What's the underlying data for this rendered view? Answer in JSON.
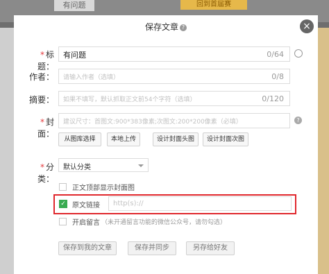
{
  "background": {
    "tab_label": "有问题",
    "banner_label": "回到首届赛"
  },
  "dialog": {
    "title": "保存文章",
    "close_label": "×"
  },
  "fields": {
    "title": {
      "label": "标题：",
      "value": "有问题",
      "count": "0/64"
    },
    "author": {
      "label": "作者：",
      "placeholder": "请输入作者（选填）",
      "count": "0/8"
    },
    "summary": {
      "label": "摘要：",
      "placeholder": "如果不填写，默认抓取正文前54个字符（选填）",
      "count": "0/120"
    },
    "cover": {
      "label": "封面：",
      "placeholder": "建议尺寸：首图文:900*383像素;次图文:200*200像素（必填）"
    }
  },
  "cover_buttons": [
    "从图库选择",
    "本地上传",
    "设计封面头图",
    "设计封面次图"
  ],
  "category": {
    "label": "分类：",
    "selected": "默认分类"
  },
  "options": {
    "show_cover": "正文顶部显示封面图",
    "source_link": {
      "label": "原文链接",
      "placeholder": "http(s)://"
    },
    "comments": {
      "label": "开启留言",
      "note": "（未开通留言功能的微信公众号，请勿勾选）"
    }
  },
  "actions": [
    "保存到我的文章",
    "保存并同步",
    "另存给好友"
  ],
  "colors": {
    "required_star": "#e4393c",
    "checkbox_checked": "#3aab52",
    "highlight": "#e0262c"
  }
}
